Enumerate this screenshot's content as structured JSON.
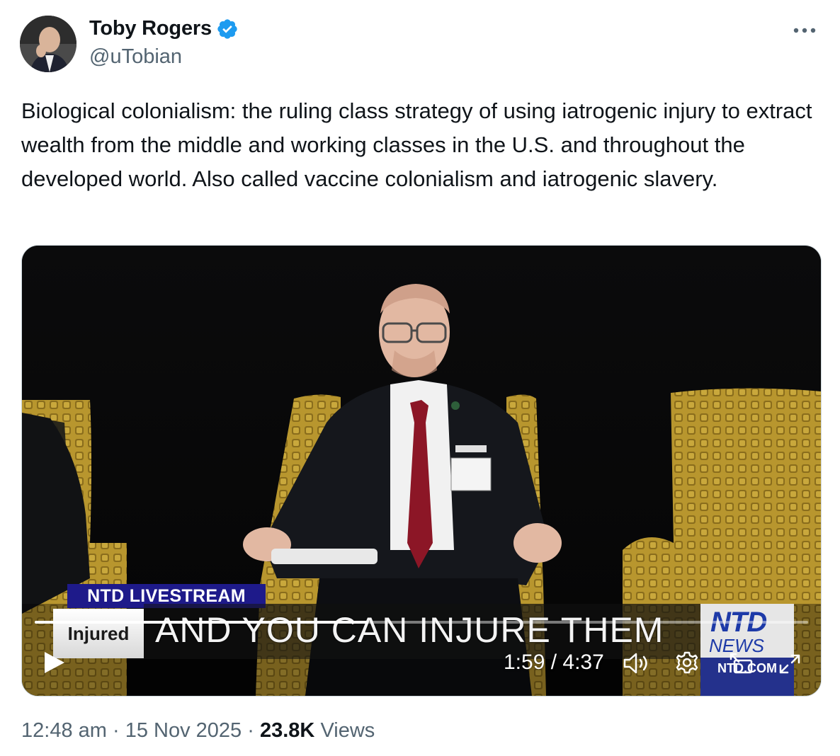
{
  "author": {
    "display_name": "Toby Rogers",
    "handle": "@uTobian",
    "verified": true,
    "verified_color": "#1d9bf0"
  },
  "more_icon": "more-horizontal-icon",
  "tweet": {
    "text": "Biological colonialism: the ruling class strategy of using iatrogenic injury to extract wealth from the middle and working classes in the U.S. and throughout the developed world. Also called vaccine colonialism and iatrogenic slavery."
  },
  "video": {
    "livestream_tag": "NTD LIVESTREAM",
    "topic_tag": "Injured",
    "headline": "AND YOU CAN INJURE THEM",
    "logo_top": "NTD",
    "logo_bottom": "NEWS",
    "logo_url": "NTD.COM",
    "current_time": "1:59",
    "duration": "4:37",
    "time_display": "1:59 / 4:37",
    "progress_fraction": 0.43,
    "controls": [
      "play-icon",
      "volume-icon",
      "settings-gear-icon",
      "picture-in-picture-icon",
      "fullscreen-icon"
    ]
  },
  "meta": {
    "time": "12:48 am",
    "separator": "·",
    "date": "15 Nov 2025",
    "views_count": "23.8K",
    "views_label": "Views"
  }
}
